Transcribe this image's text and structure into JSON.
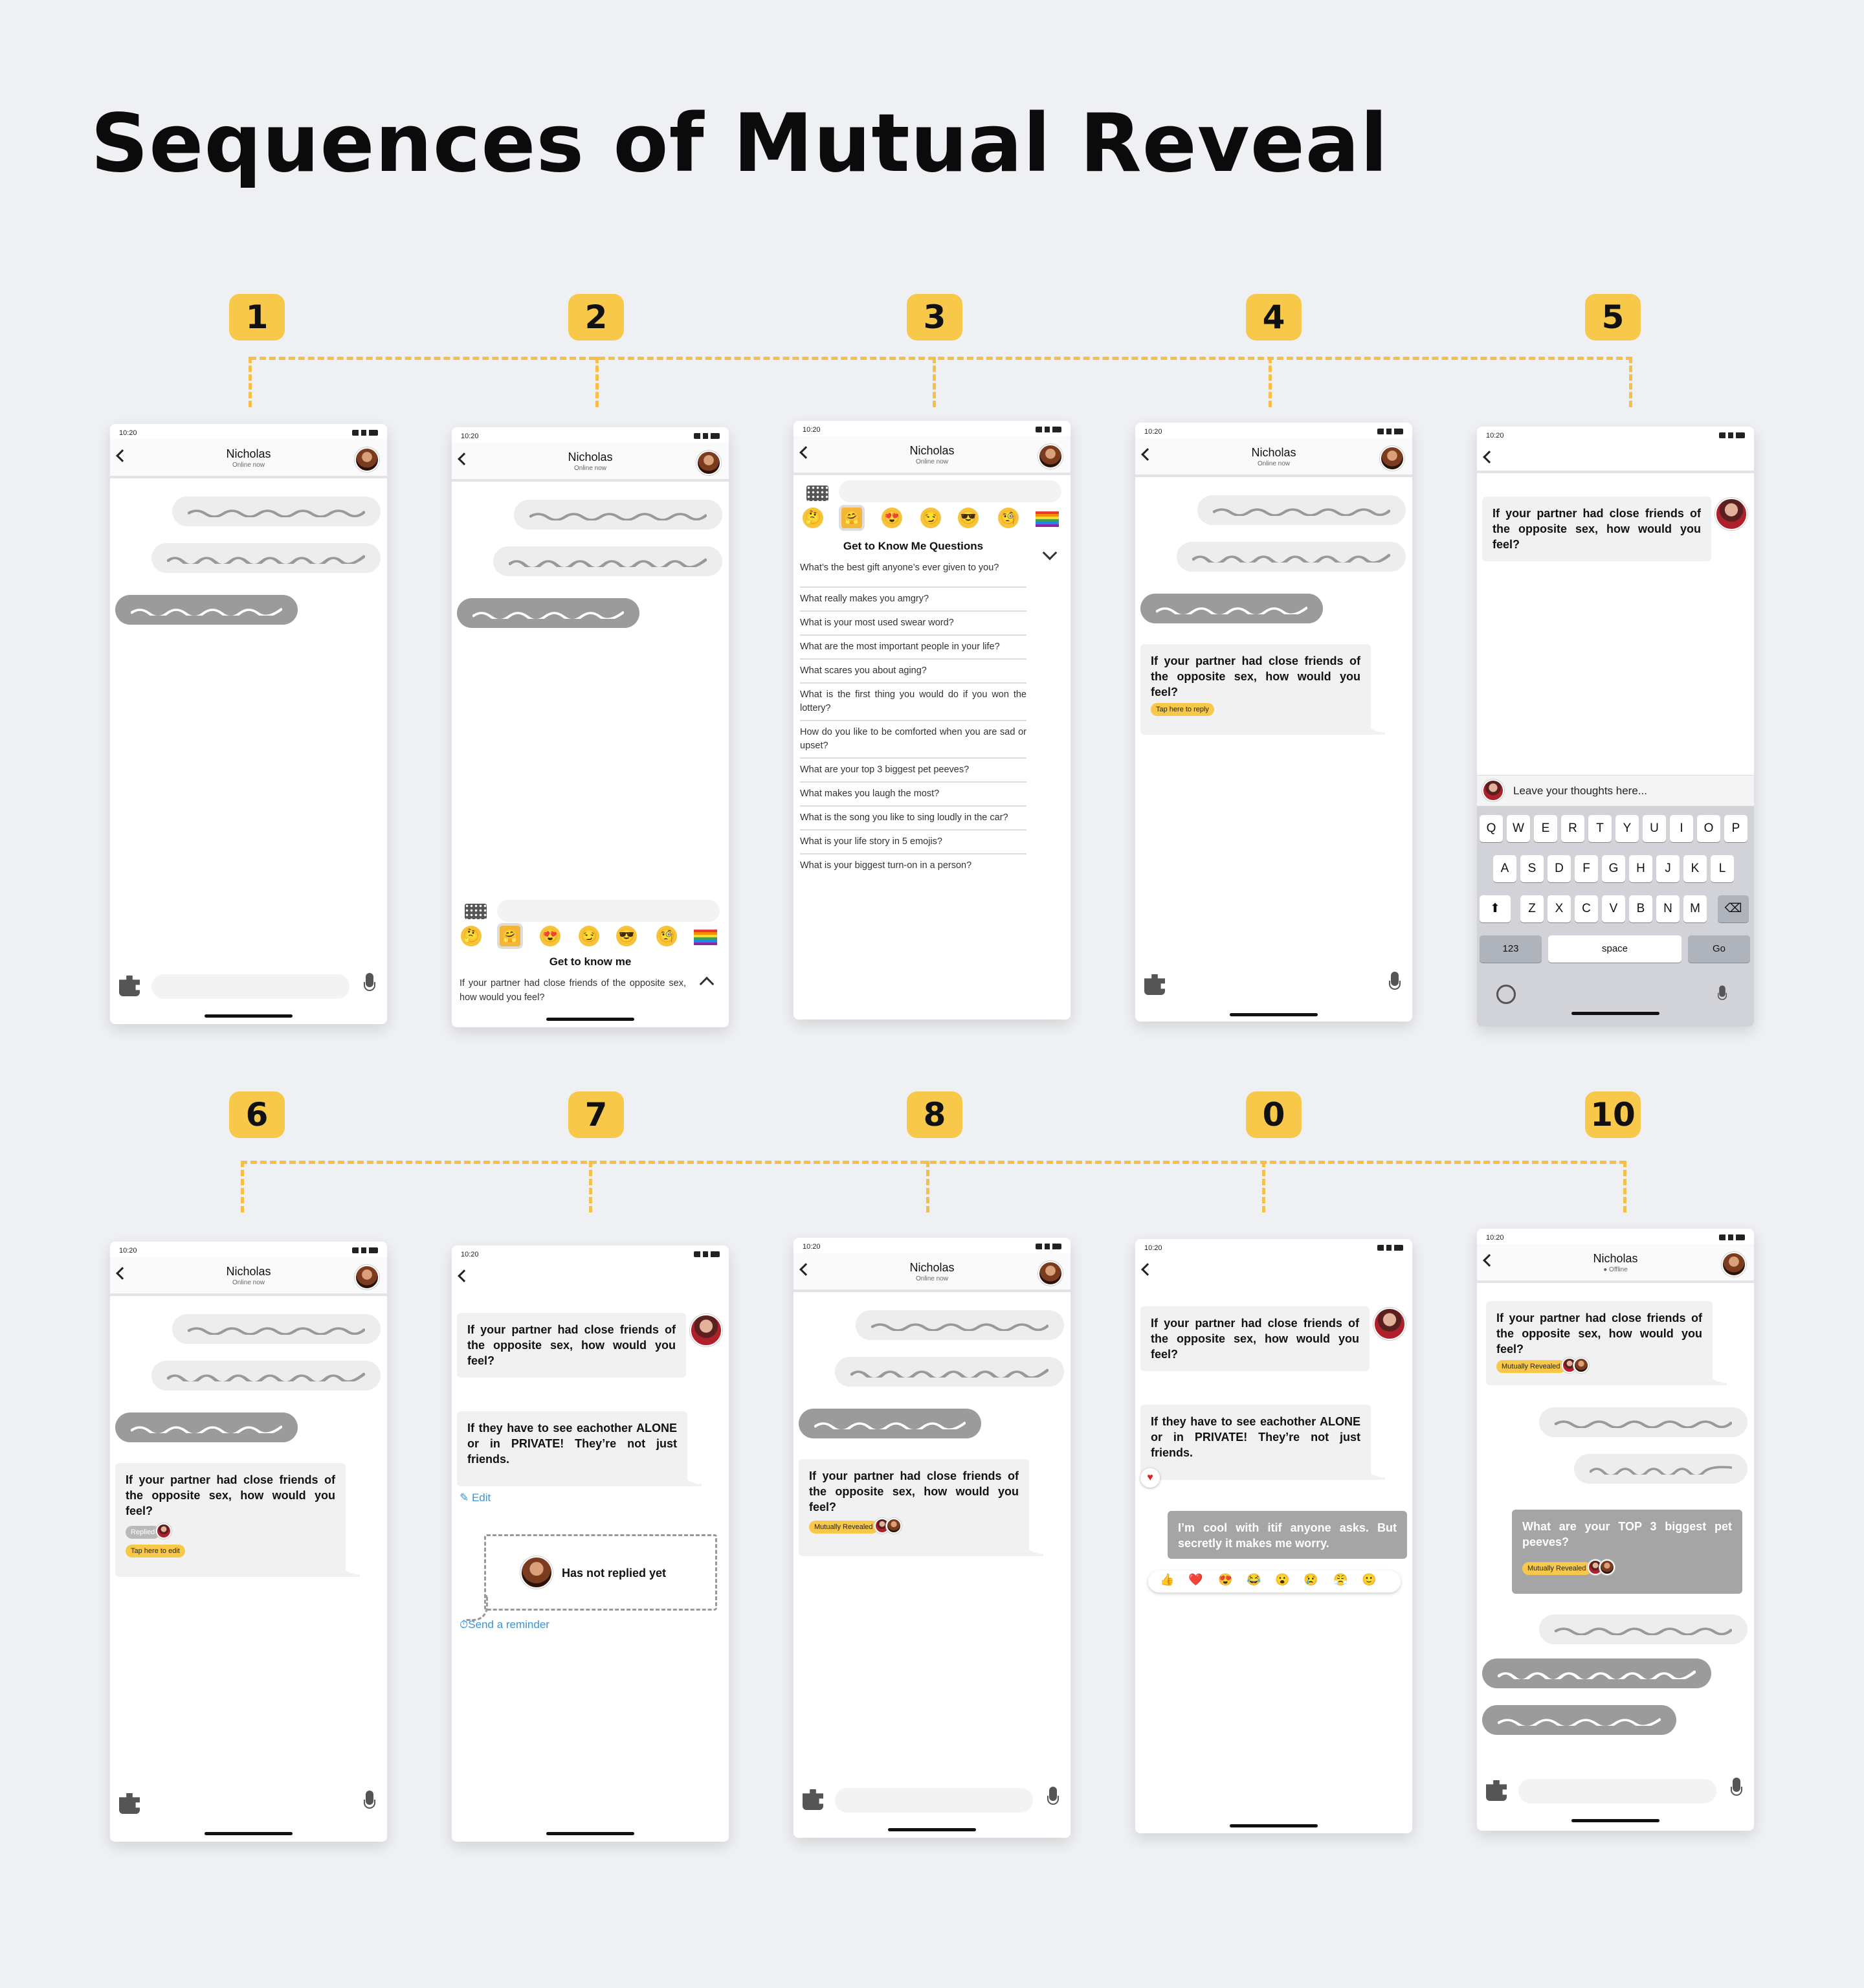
{
  "title": "Sequences of Mutual Reveal",
  "steps": [
    "1",
    "2",
    "3",
    "4",
    "5",
    "6",
    "7",
    "8",
    "0",
    "10"
  ],
  "status_time": "10:20",
  "contact": {
    "name": "Nicholas",
    "online": "Online now",
    "offline": "Offline"
  },
  "question": "If your partner had close friends of the opposite sex, how would you feel?",
  "question_pre": "If your partner had close friends of the opposite sex, how would you feel?",
  "answer": "If they have to see eachother ALONE or in PRIVATE! They’re not just friends.",
  "reply": "I’m cool with itif anyone asks. But secretly it makes me worry.",
  "pet_peeves_q": "What are your TOP 3 biggest pet peeves?",
  "labels": {
    "get_to_know": "Get to know me",
    "get_to_know_q": "Get to Know Me Questions",
    "tap_reply": "Tap here to reply",
    "tap_edit": "Tap here to edit",
    "replied": "Replied",
    "mutually": "Mutually Revealed",
    "edit": "Edit",
    "not_replied": "Has not replied yet",
    "reminder": "Send a reminder",
    "leave_thoughts": "Leave your thoughts here...",
    "k123": "123",
    "space": "space",
    "go": "Go"
  },
  "gkm_questions": [
    "What’s the best gift anyone’s ever given to you?",
    "What really makes you amgry?",
    "What is your most used swear word?",
    "What are the most important people in your life?",
    "What scares you about aging?",
    "What is the first thing you would do if you won the lottery?",
    "How do you like to be comforted when you are sad or upset?",
    "What are your top 3 biggest pet peeves?",
    "What makes you laugh the most?",
    "What is the song you like to sing loudly in the car?",
    "What is your life story in 5 emojis?",
    "What is your biggest turn-on in a person?"
  ],
  "keyboard": {
    "row1": [
      "Q",
      "W",
      "E",
      "R",
      "T",
      "Y",
      "U",
      "I",
      "O",
      "P"
    ],
    "row2": [
      "A",
      "S",
      "D",
      "F",
      "G",
      "H",
      "J",
      "K",
      "L"
    ],
    "row3": [
      "Z",
      "X",
      "C",
      "V",
      "B",
      "N",
      "M"
    ]
  },
  "emojis": [
    "🤔",
    "🤗",
    "😍",
    "😏",
    "😎",
    "🧐"
  ],
  "reactions": [
    "👍",
    "❤️",
    "😍",
    "😂",
    "😮",
    "😢",
    "😤",
    "🙂"
  ],
  "colors": {
    "accent": "#f8c84a",
    "dashed": "#f4c04a",
    "bubble_dark": "#9b9b9b",
    "bubble_light": "#ededed",
    "link": "#3a95d4"
  }
}
